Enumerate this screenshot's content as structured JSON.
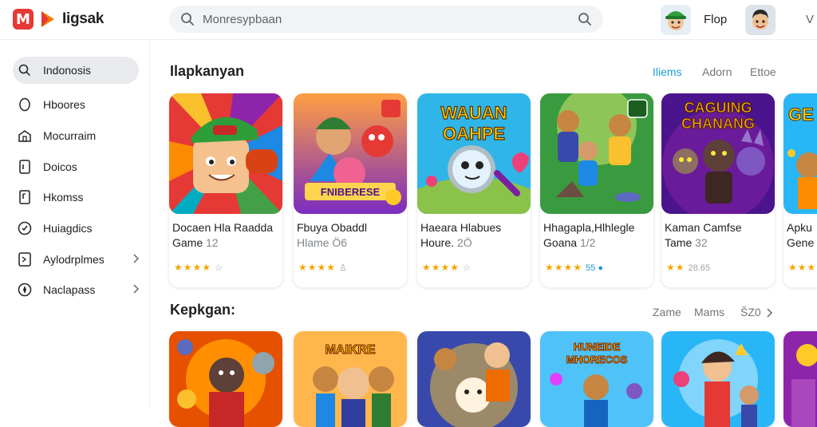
{
  "header": {
    "brand": "Iigsak",
    "search_placeholder": "Monresypbaan",
    "top_link": "Flop",
    "edge_text": "V"
  },
  "sidebar": {
    "items": [
      {
        "label": "Indonosis",
        "icon": "search-icon",
        "active": true
      },
      {
        "label": "Hboores",
        "icon": "circle-icon"
      },
      {
        "label": "Mocurraim",
        "icon": "home-icon"
      },
      {
        "label": "Doicos",
        "icon": "tablet-icon"
      },
      {
        "label": "Hkomss",
        "icon": "document-icon"
      },
      {
        "label": "Huiagdics",
        "icon": "shield-icon"
      },
      {
        "label": "Aylodrplmes",
        "icon": "tag-icon",
        "chevron": true
      },
      {
        "label": "Naclapass",
        "icon": "compass-icon",
        "chevron": true
      }
    ]
  },
  "section1": {
    "title": "Ilapkanyan",
    "links": [
      "Iliems",
      "Adorn",
      "Ettoe"
    ],
    "cards": [
      {
        "line1": "Docaen Hla Raadda",
        "line2": "Game",
        "line2b": "12",
        "stars": "★★★★",
        "extra": "☆"
      },
      {
        "line1": "Fbuya Obaddl",
        "line2": "Hlame",
        "line2b": "Ö6",
        "stars": "★★★★",
        "extra": "♙"
      },
      {
        "line1": "Haeara Hlabues",
        "line2": "Houre.",
        "line2b": "2Ö",
        "stars": "★★★★",
        "extra": "☆"
      },
      {
        "line1": "Hhagapla,Hlhlegle",
        "line2": "Goana",
        "line2b": "1/2",
        "stars": "★★★★",
        "extra": "55 ●"
      },
      {
        "line1": "Kaman Camfse",
        "line2": "Tame",
        "line2b": "32",
        "stars": "★★",
        "extra": "28.65"
      },
      {
        "line1": "Apku",
        "line2": "Gene",
        "line2b": "",
        "stars": "★★★",
        "extra": ""
      }
    ]
  },
  "section2": {
    "title": "Kepkgan:",
    "links": [
      "Zame",
      "Mams",
      "ŠZ0"
    ]
  },
  "colors": {
    "accent": "#1a9bd7",
    "star": "#f2a600",
    "active_bg": "#e8eaed"
  }
}
